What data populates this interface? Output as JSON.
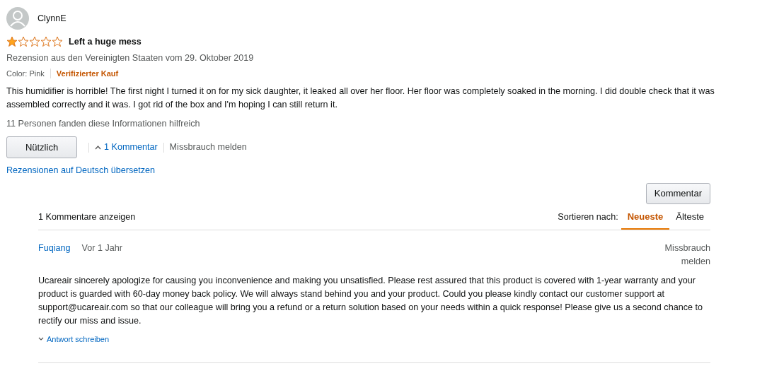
{
  "review": {
    "author": "ClynnE",
    "stars": 1,
    "title": "Left a huge mess",
    "meta": "Rezension aus den Vereinigten Staaten vom 29. Oktober 2019",
    "variant": "Color: Pink",
    "verified": "Verifizierter Kauf",
    "body": "This humidifier is horrible! The first night I turned it on for my sick daughter, it leaked all over her floor. Her floor was completely soaked in the morning. I did double check that it was assembled correctly and it was. I got rid of the box and I'm hoping I can still return it.",
    "helpful_count": "11 Personen fanden diese Informationen hilfreich",
    "helpful_button": "Nützlich",
    "comments_link": {
      "label": "1 Kommentar",
      "expanded": true
    },
    "report": "Missbrauch melden",
    "translate": "Rezensionen auf Deutsch übersetzen"
  },
  "comments": {
    "add_button": "Kommentar",
    "count_label": "1 Kommentare anzeigen",
    "sort_label": "Sortieren nach:",
    "sort_tabs": [
      {
        "label": "Neueste",
        "selected": true
      },
      {
        "label": "Älteste",
        "selected": false
      }
    ],
    "items": [
      {
        "author": "Fuqiang",
        "time": "Vor 1 Jahr",
        "report": "Missbrauch melden",
        "text": "Ucareair sincerely apologize for causing you inconvenience and making you unsatisfied. Please rest assured that this product is covered with 1-year warranty and your product is guarded with 60-day money back policy. We will always stand behind you and your product. Could you please kindly contact our customer support at support@ucareair.com so that our colleague will bring you a refund or a return solution based on your needs within a quick response! Please give us a second chance to rectify our miss and issue.",
        "reply_link": "Antwort schreiben"
      }
    ]
  }
}
